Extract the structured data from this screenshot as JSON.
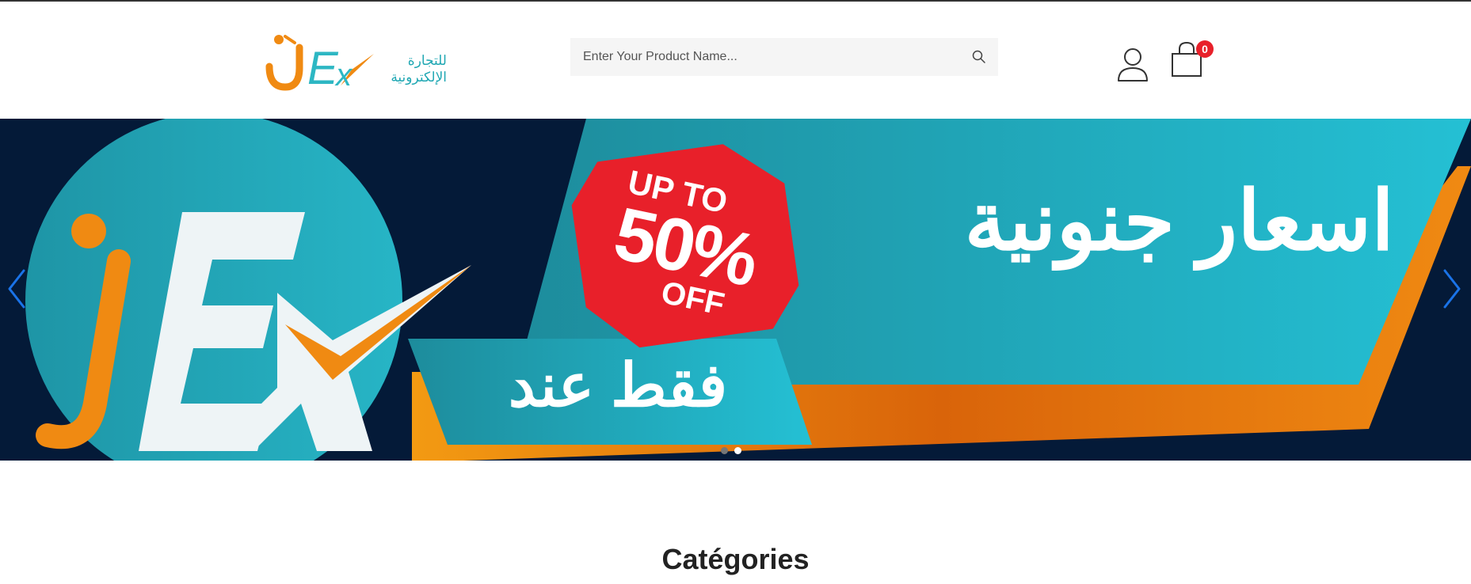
{
  "header": {
    "logo_text": "jEx",
    "logo_arabic_line1": "للتجارة",
    "logo_arabic_line2": "الإلكترونية",
    "search": {
      "placeholder": "Enter Your Product Name..."
    },
    "cart_count": "0"
  },
  "banner": {
    "headline": "اسعار جنونية",
    "subline": "فقط عند",
    "promo_line1": "UP TO",
    "promo_line2": "50%",
    "promo_line3": "OFF",
    "logo_text": "jEx",
    "active_slide": 2,
    "slide_count": 2
  },
  "categories": {
    "title": "Catégories"
  },
  "colors": {
    "accent_orange": "#f08a12",
    "teal": "#1fa7b3",
    "navy": "#041a38",
    "badge_red": "#e8202a",
    "arrow_blue": "#1a73e8"
  },
  "icons": [
    "search-icon",
    "user-icon",
    "shopping-bag-icon",
    "chevron-left-icon",
    "chevron-right-icon"
  ]
}
